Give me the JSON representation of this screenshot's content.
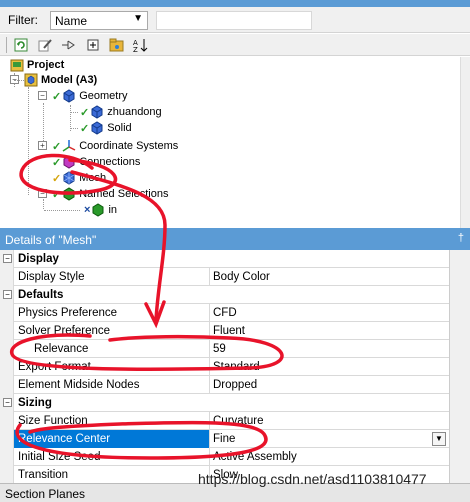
{
  "outline": {
    "filter_label": "Filter:",
    "filter_value": "Name",
    "tree": [
      {
        "label": "Project",
        "bold": true
      },
      {
        "label": "Model (A3)",
        "bold": true
      },
      {
        "label": "Geometry"
      },
      {
        "label": "zhuandong"
      },
      {
        "label": "Solid"
      },
      {
        "label": "Coordinate Systems"
      },
      {
        "label": "Connections"
      },
      {
        "label": "Mesh"
      },
      {
        "label": "Named Selections"
      },
      {
        "label": "in"
      }
    ]
  },
  "details": {
    "title": "Details of \"Mesh\"",
    "pin": "†",
    "rows": [
      {
        "key": "Display",
        "value": ""
      },
      {
        "key": "Display Style",
        "value": "Body Color"
      },
      {
        "key": "Defaults",
        "value": ""
      },
      {
        "key": "Physics Preference",
        "value": "CFD"
      },
      {
        "key": "Solver Preference",
        "value": "Fluent"
      },
      {
        "key": "Relevance",
        "value": "59"
      },
      {
        "key": "Export Format",
        "value": "Standard"
      },
      {
        "key": "Element Midside Nodes",
        "value": "Dropped"
      },
      {
        "key": "Sizing",
        "value": ""
      },
      {
        "key": "Size Function",
        "value": "Curvature"
      },
      {
        "key": "Relevance Center",
        "value": "Fine"
      },
      {
        "key": "Initial Size Seed",
        "value": "Active Assembly"
      },
      {
        "key": "Transition",
        "value": "Slow"
      }
    ]
  },
  "bottom": {
    "section_planes": "Section Planes",
    "watermark": "https://blog.csdn.net/asd1103810477"
  },
  "colors": {
    "title_bar": "#5b9bd5",
    "selection": "#0078d7",
    "annotation": "#e8132a"
  }
}
